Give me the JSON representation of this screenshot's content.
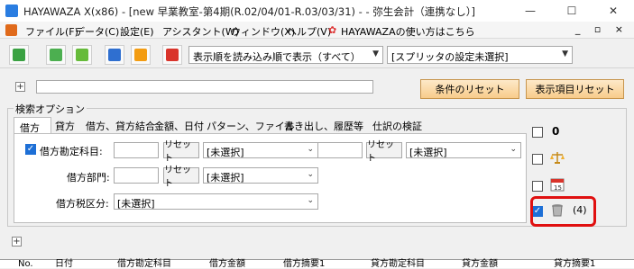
{
  "window": {
    "title": "HAYAWAZA X(x86) - [new 早業教室-第4期(R.02/04/01-R.03/03/31) - - 弥生会計（連携なし）]",
    "controls": [
      "—",
      "☐",
      "✕"
    ]
  },
  "menu": {
    "items": [
      "ファイル(F)",
      "データ(C)",
      "設定(E)",
      "アシスタント(W)",
      "ウィンドウ(X)",
      "ヘルプ(V)",
      "HAYAWAZAの使い方はこちら"
    ],
    "mdi_controls": "_ ▫ ×"
  },
  "toolbar": {
    "display_order_combo": "表示順を読み込み順で表示（すべて）",
    "splitter_combo": "[スプリッタの設定未選択]",
    "icons": [
      "new-doc-icon",
      "sheet-icon",
      "edit-icon",
      "import-icon",
      "export-icon",
      "print-icon"
    ]
  },
  "filter": {
    "expand_symbol": "+",
    "reset_conditions": "条件のリセット",
    "reset_display": "表示項目リセット"
  },
  "search": {
    "group_title": "検索オプション",
    "tabs": [
      "借方",
      "貸方",
      "借方、貸方結合",
      "金額、日付",
      "パターン、ファイル",
      "書き出し、履歴等",
      "仕訳の検証"
    ],
    "debit_account_label": "借方勘定科目:",
    "debit_dept_label": "借方部門:",
    "debit_tax_label": "借方税区分:",
    "reset_label": "リセット",
    "unselected": "[未選択]",
    "debit_account_checked": true
  },
  "side_toggles": {
    "count_zero": "0",
    "trash_count": "(4)"
  },
  "grid": {
    "expand_symbol": "+",
    "columns": [
      "No.",
      "日付",
      "借方勘定科目",
      "借方金額",
      "借方摘要1",
      "貸方勘定科目",
      "貸方金額",
      "貸方摘要1"
    ]
  },
  "colors": {
    "accent_orange": "#f8cc8b",
    "highlight_red": "#e01010",
    "check_blue": "#1d6fd6"
  }
}
